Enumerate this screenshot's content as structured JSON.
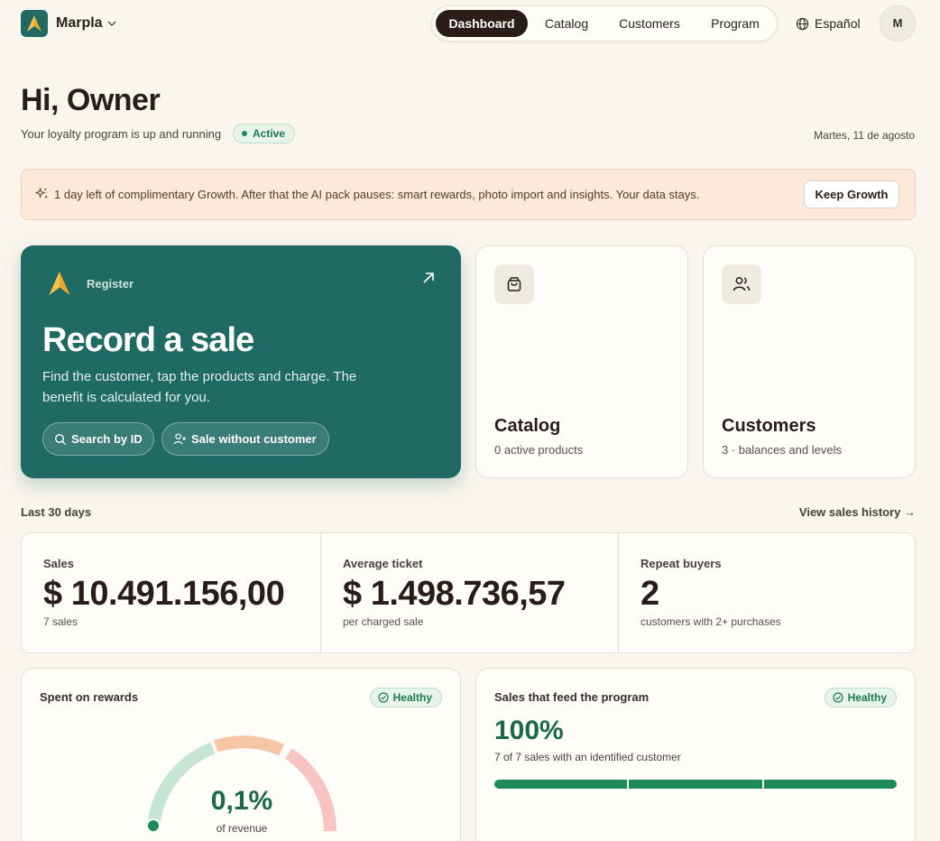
{
  "header": {
    "brand": "Marpla",
    "nav": [
      "Dashboard",
      "Catalog",
      "Customers",
      "Program"
    ],
    "active_tab": "Dashboard",
    "language": "Español",
    "avatar_initial": "M"
  },
  "greeting": {
    "title": "Hi, Owner",
    "subtitle": "Your loyalty program is up and running",
    "status": "Active",
    "date": "Martes, 11 de agosto"
  },
  "banner": {
    "text": "1 day left of complimentary Growth. After that the AI pack pauses: smart rewards, photo import and insights. Your data stays.",
    "button": "Keep Growth"
  },
  "register": {
    "label": "Register",
    "title": "Record a sale",
    "description": "Find the customer, tap the products and charge. The benefit is calculated for you.",
    "search_button": "Search by ID",
    "no_customer_button": "Sale without customer"
  },
  "catalog_card": {
    "title": "Catalog",
    "subtitle": "0 active products"
  },
  "customers_card": {
    "title": "Customers",
    "subtitle": "3 · balances and levels"
  },
  "section": {
    "label": "Last 30 days",
    "link": "View sales history →"
  },
  "stats": [
    {
      "label": "Sales",
      "value": "$ 10.491.156,00",
      "sub": "7 sales"
    },
    {
      "label": "Average ticket",
      "value": "$ 1.498.736,57",
      "sub": "per charged sale"
    },
    {
      "label": "Repeat buyers",
      "value": "2",
      "sub": "customers with 2+ purchases"
    }
  ],
  "rewards_panel": {
    "title": "Spent on rewards",
    "badge": "Healthy",
    "value": "0,1%",
    "sub": "of revenue",
    "gauge_fraction": 0.001
  },
  "feed_panel": {
    "title": "Sales that feed the program",
    "badge": "Healthy",
    "value": "100%",
    "sub": "7 of 7 sales with an identified customer",
    "fraction": 1.0
  },
  "colors": {
    "brand": "#1f6b63",
    "accent_gold": "#e8a829",
    "success": "#1e8a55",
    "background": "#faf6ee"
  }
}
